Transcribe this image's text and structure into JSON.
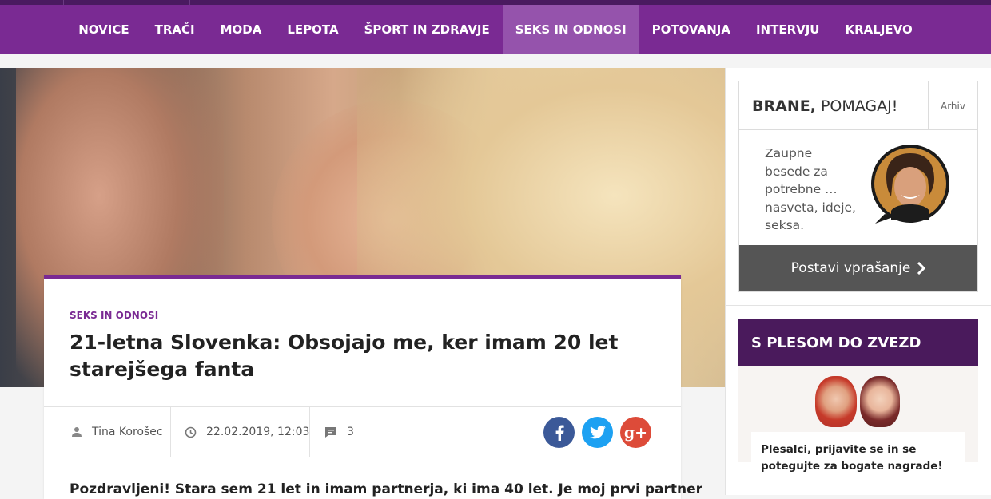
{
  "nav": {
    "items": [
      {
        "label": "NOVICE"
      },
      {
        "label": "TRAČI"
      },
      {
        "label": "MODA"
      },
      {
        "label": "LEPOTA"
      },
      {
        "label": "ŠPORT IN ZDRAVJE"
      },
      {
        "label": "SEKS IN ODNOSI",
        "active": true
      },
      {
        "label": "POTOVANJA"
      },
      {
        "label": "INTERVJU"
      },
      {
        "label": "KRALJEVO"
      }
    ]
  },
  "article": {
    "category": "SEKS IN ODNOSI",
    "title": "21-letna Slovenka: Obsojajo me, ker imam 20 let starejšega fanta",
    "author": "Tina Korošec",
    "date": "22.02.2019, 12:03",
    "comments": "3",
    "lead": "Pozdravljeni! Stara sem 21 let in imam partnerja, ki ima 40 let. Je moj prvi partner",
    "hero_icon": "photo-kissing-couple",
    "share": {
      "facebook_icon": "facebook-icon",
      "twitter_icon": "twitter-icon",
      "gplus_label": "g+"
    }
  },
  "sidebar": {
    "brane": {
      "title_bold": "BRANE,",
      "title_rest": " POMAGAJ!",
      "archive": "Arhiv",
      "text": "Zaupne besede za potrebne … nasveta, ideje, seksa.",
      "button": "Postavi vprašanje"
    },
    "plesom": {
      "title": "S PLESOM DO ZVEZD",
      "caption": "Plesalci, prijavite se in se potegujte za bogate nagrade!"
    }
  },
  "colors": {
    "brand_purple": "#7a2a93",
    "nav_active": "#9553ac",
    "dark_purple": "#4a1a5c",
    "facebook": "#3b5998",
    "twitter": "#1da1f2",
    "gplus": "#dd4b39",
    "button_gray": "#555555"
  }
}
